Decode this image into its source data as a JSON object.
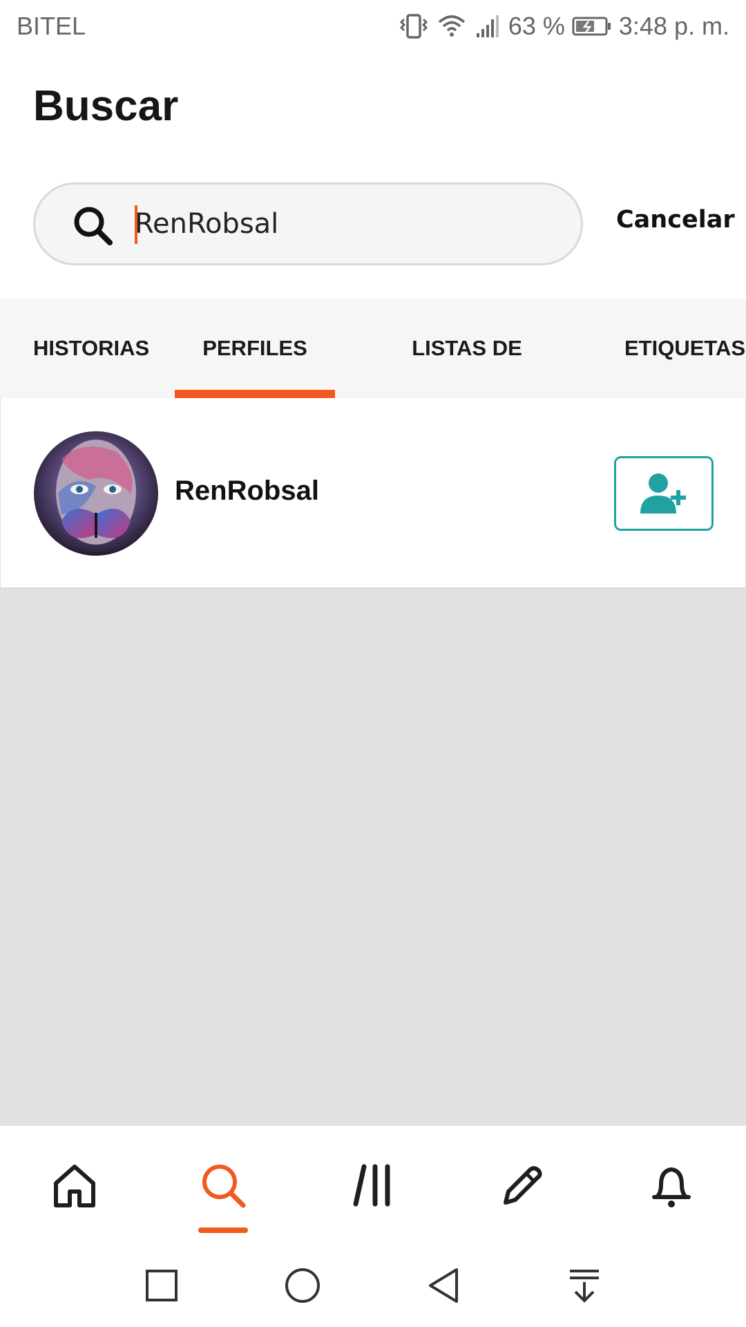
{
  "status_bar": {
    "carrier": "BITEL",
    "battery": "63 %",
    "time": "3:48 p. m.",
    "icons": [
      "vibrate-icon",
      "wifi-icon",
      "signal-icon",
      "battery-icon"
    ]
  },
  "header": {
    "title": "Buscar"
  },
  "search": {
    "value": "RenRobsal",
    "cancel_label": "Cancelar",
    "icon": "search-icon"
  },
  "tabs": [
    {
      "label": "HISTORIAS",
      "active": false
    },
    {
      "label": "PERFILES",
      "active": true
    },
    {
      "label": "LISTAS DE LECTURA",
      "active": false
    },
    {
      "label": "ETIQUETAS",
      "active": false
    }
  ],
  "results": [
    {
      "username": "RenRobsal",
      "avatar": "avatar-image",
      "action_icon": "add-user-icon"
    }
  ],
  "bottom_nav": {
    "items": [
      "home-icon",
      "search-icon",
      "library-icon",
      "write-icon",
      "notifications-icon"
    ],
    "active_index": 1
  },
  "system_nav": [
    "recents-icon",
    "home-circle-icon",
    "back-icon",
    "notification-pull-icon"
  ],
  "colors": {
    "accent": "#f05a1e",
    "teal": "#20a2a2",
    "empty_bg": "#e1e1e1"
  }
}
